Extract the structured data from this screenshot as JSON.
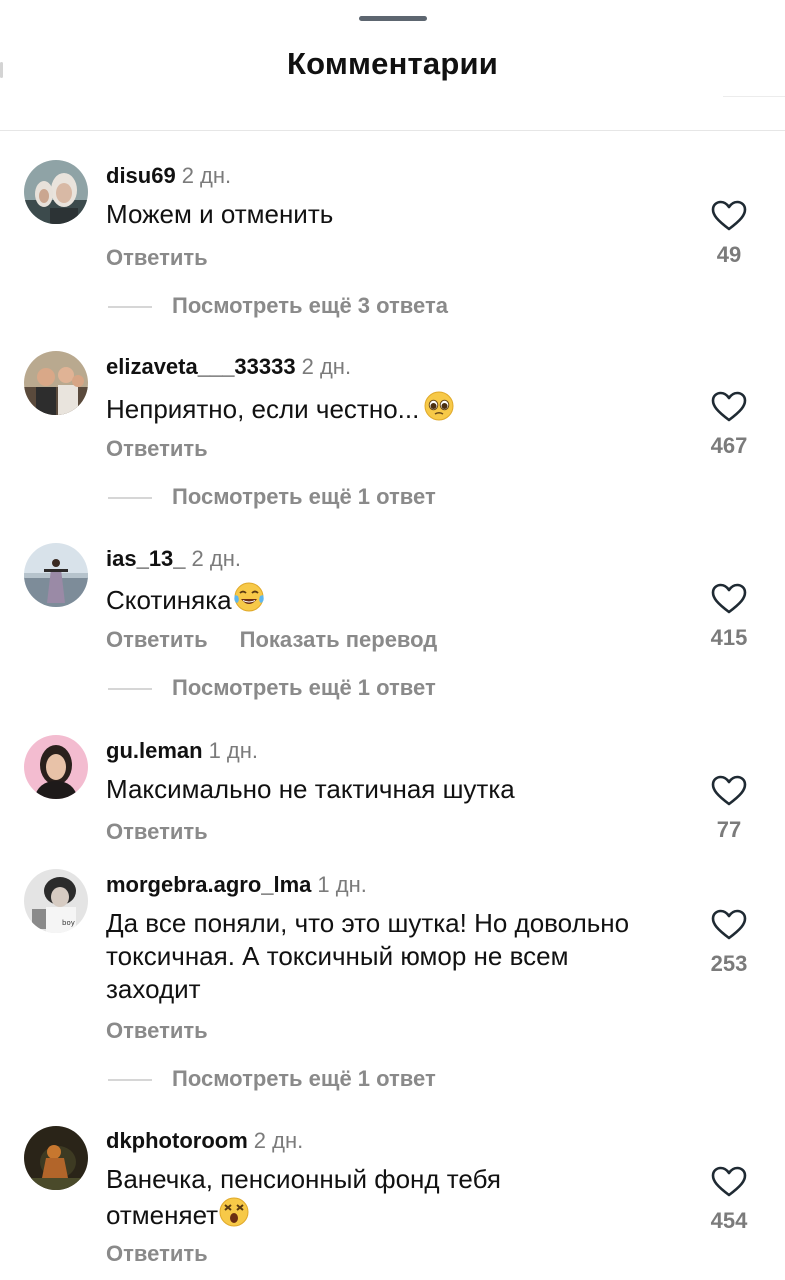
{
  "header": {
    "title": "Комментарии"
  },
  "comments": [
    {
      "username": "disu69",
      "time": "2 дн.",
      "text": "Можем и отменить",
      "reply_label": "Ответить",
      "likes": "49",
      "more_replies": "Посмотреть ещё 3 ответа"
    },
    {
      "username": "elizaveta___33333",
      "time": "2 дн.",
      "text": "Неприятно, если честно...",
      "emoji": "pleading-face",
      "reply_label": "Ответить",
      "likes": "467",
      "more_replies": "Посмотреть ещё 1 ответ"
    },
    {
      "username": "ias_13_",
      "time": "2 дн.",
      "text": "Скотиняка",
      "emoji": "tears-of-joy-face",
      "reply_label": "Ответить",
      "translate_label": "Показать перевод",
      "likes": "415",
      "more_replies": "Посмотреть ещё 1 ответ"
    },
    {
      "username": "gu.leman",
      "time": "1 дн.",
      "text": "Максимально не тактичная шутка",
      "reply_label": "Ответить",
      "likes": "77"
    },
    {
      "username": "morgebra.agro_lma",
      "time": "1 дн.",
      "text": "Да все поняли, что это шутка! Но довольно токсичная. А токсичный юмор не всем заходит",
      "reply_label": "Ответить",
      "likes": "253",
      "more_replies": "Посмотреть ещё 1 ответ"
    },
    {
      "username": "dkphotoroom",
      "time": "2 дн.",
      "text": "Ванечка, пенсионный фонд тебя отменяет",
      "emoji": "astonished-face",
      "reply_label": "Ответить",
      "likes": "454"
    }
  ],
  "colors": {
    "text": "#111111",
    "muted": "#8a8a8a",
    "divider": "#e6e6e6",
    "handle": "#5d6670",
    "heart_stroke": "#1f2a33"
  }
}
